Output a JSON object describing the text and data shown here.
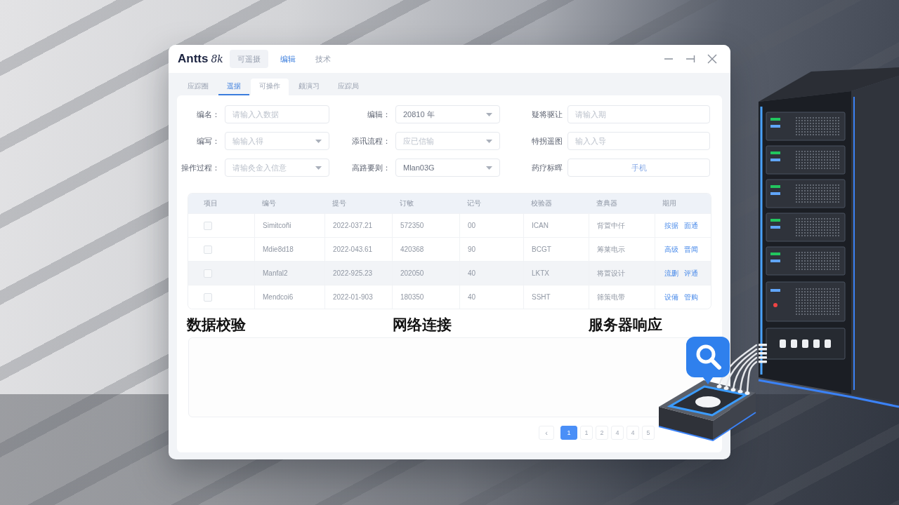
{
  "window": {
    "brand": "Antts",
    "brand_suffix": "8k",
    "nav_tabs": [
      {
        "label": "可遥摄",
        "selected": false,
        "highlighted": true
      },
      {
        "label": "编辑",
        "selected": true,
        "highlighted": false
      },
      {
        "label": "技术",
        "selected": false,
        "highlighted": false
      }
    ]
  },
  "sub_tabs": [
    {
      "label": "应踪圈",
      "selected": false,
      "highlighted": false
    },
    {
      "label": "遥据",
      "selected": true,
      "highlighted": false
    },
    {
      "label": "可操作",
      "selected": false,
      "highlighted": true
    },
    {
      "label": "颇演习",
      "selected": false,
      "highlighted": false
    },
    {
      "label": "应踪局",
      "selected": false,
      "highlighted": false
    }
  ],
  "form": {
    "fields": [
      {
        "label": "编名：",
        "kind": "input",
        "placeholder": "请输入入数据"
      },
      {
        "label": "编辑：",
        "kind": "select",
        "value": "20810 年"
      },
      {
        "label": "疑将驱让",
        "kind": "input",
        "placeholder": "请输入期"
      },
      {
        "label": "编写：",
        "kind": "select",
        "placeholder": "输输入得"
      },
      {
        "label": "添讯流程：",
        "kind": "select",
        "placeholder": "应已信输"
      },
      {
        "label": "特拐遥图",
        "kind": "input",
        "placeholder": "输入入导"
      },
      {
        "label": "操作过程：",
        "kind": "select",
        "placeholder": "请输灸金入信意"
      },
      {
        "label": "高路要则：",
        "kind": "select",
        "value": "Mlan03G"
      },
      {
        "label": "药疗标晖",
        "kind": "button",
        "text": "手机"
      }
    ]
  },
  "table": {
    "columns": [
      "项目",
      "编号",
      "提号",
      "订敏",
      "记号",
      "校验器",
      "查典器",
      "期用"
    ],
    "rows": [
      {
        "highlighted": false,
        "cells": [
          {
            "kind": "checkbox",
            "checked": false
          },
          {
            "kind": "text",
            "text": "Simitcoñi"
          },
          {
            "kind": "text",
            "text": "2022-037.21"
          },
          {
            "kind": "text",
            "text": "572350"
          },
          {
            "kind": "text",
            "text": "00"
          },
          {
            "kind": "text",
            "text": "ICAN"
          },
          {
            "kind": "text",
            "text": "背置中仟"
          },
          {
            "kind": "links",
            "links": [
              "按据",
              "面通"
            ]
          }
        ]
      },
      {
        "highlighted": false,
        "cells": [
          {
            "kind": "checkbox",
            "checked": false
          },
          {
            "kind": "text",
            "text": "Mdie8d18"
          },
          {
            "kind": "text",
            "text": "2022-043.61"
          },
          {
            "kind": "text",
            "text": "420368"
          },
          {
            "kind": "text",
            "text": "90"
          },
          {
            "kind": "text",
            "text": "BCGT"
          },
          {
            "kind": "text",
            "text": "筹莱电示"
          },
          {
            "kind": "links",
            "links": [
              "高级",
              "晋闻"
            ]
          }
        ]
      },
      {
        "highlighted": true,
        "cells": [
          {
            "kind": "checkbox",
            "checked": false
          },
          {
            "kind": "text",
            "text": "Manfal2"
          },
          {
            "kind": "text",
            "text": "2022-925.23"
          },
          {
            "kind": "text",
            "text": "202050"
          },
          {
            "kind": "text",
            "text": "40"
          },
          {
            "kind": "text",
            "text": "LKTX"
          },
          {
            "kind": "text",
            "text": "将置设计"
          },
          {
            "kind": "links",
            "links": [
              "流删",
              "评通"
            ]
          }
        ]
      },
      {
        "highlighted": false,
        "cells": [
          {
            "kind": "checkbox",
            "checked": false
          },
          {
            "kind": "text",
            "text": "Mendcoi6"
          },
          {
            "kind": "text",
            "text": "2022-01-903"
          },
          {
            "kind": "text",
            "text": "180350"
          },
          {
            "kind": "text",
            "text": "40"
          },
          {
            "kind": "text",
            "text": "SSHT"
          },
          {
            "kind": "text",
            "text": "筛策电带"
          },
          {
            "kind": "links",
            "links": [
              "设備",
              "管购"
            ]
          }
        ]
      }
    ]
  },
  "sections": [
    "数据校验",
    "网络连接",
    "服务器响应"
  ],
  "pagination": {
    "prev": "‹",
    "pages": [
      {
        "label": "1",
        "selected": true
      },
      {
        "label": "1",
        "selected": false
      },
      {
        "label": "2",
        "selected": false
      },
      {
        "label": "4",
        "selected": false
      },
      {
        "label": "4",
        "selected": false
      },
      {
        "label": "5",
        "selected": false
      }
    ]
  }
}
